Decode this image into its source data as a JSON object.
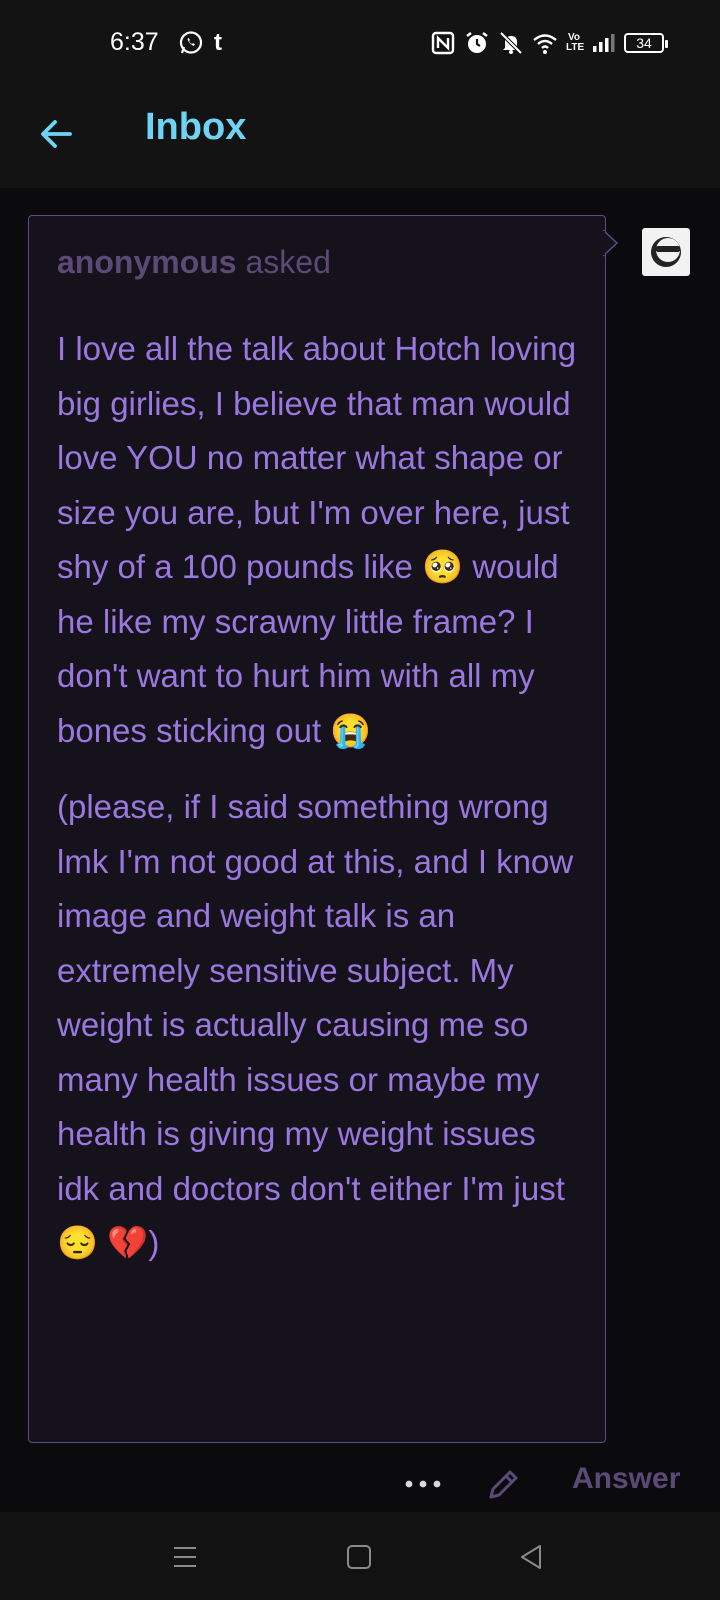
{
  "status_bar": {
    "time": "6:37",
    "left_icons": [
      "whatsapp-icon",
      "tumblr-icon"
    ],
    "tumblr_glyph": "t",
    "right_icons": [
      "nfc-icon",
      "alarm-icon",
      "mute-icon",
      "wifi-icon",
      "volte-icon",
      "signal-icon",
      "battery-icon"
    ],
    "volte_label": "Vo LTE",
    "battery_level": "34"
  },
  "header": {
    "back_icon": "arrow-left-icon",
    "title": "Inbox",
    "title_color": "#6ed3f4"
  },
  "ask": {
    "asker_name": "anonymous",
    "asked_label": " asked",
    "paragraphs": [
      "I love all the talk about Hotch loving big girlies, I believe that man would love YOU no matter what shape or size you are, but I'm over here, just shy of a 100 pounds like 🥺  would he like my scrawny little frame? I don't want to hurt him with all my bones sticking out 😭",
      "(please, if I said something wrong lmk I'm not good at this, and I know image and weight talk is an extremely sensitive subject. My weight is actually causing me so many health issues or maybe my health is giving my weight issues idk and doctors don't either I'm just 😔 💔)"
    ],
    "text_color": "#9a78e0",
    "border_color": "#5d4a86",
    "recipient_avatar_icon": "sunglasses-avatar-icon"
  },
  "actions": {
    "more_icon": "more-dots-icon",
    "edit_icon": "pencil-icon",
    "answer_label": "Answer",
    "muted_color": "#5a4a75"
  },
  "nav": {
    "icons": [
      "menu-icon",
      "home-square-icon",
      "back-triangle-icon"
    ]
  }
}
